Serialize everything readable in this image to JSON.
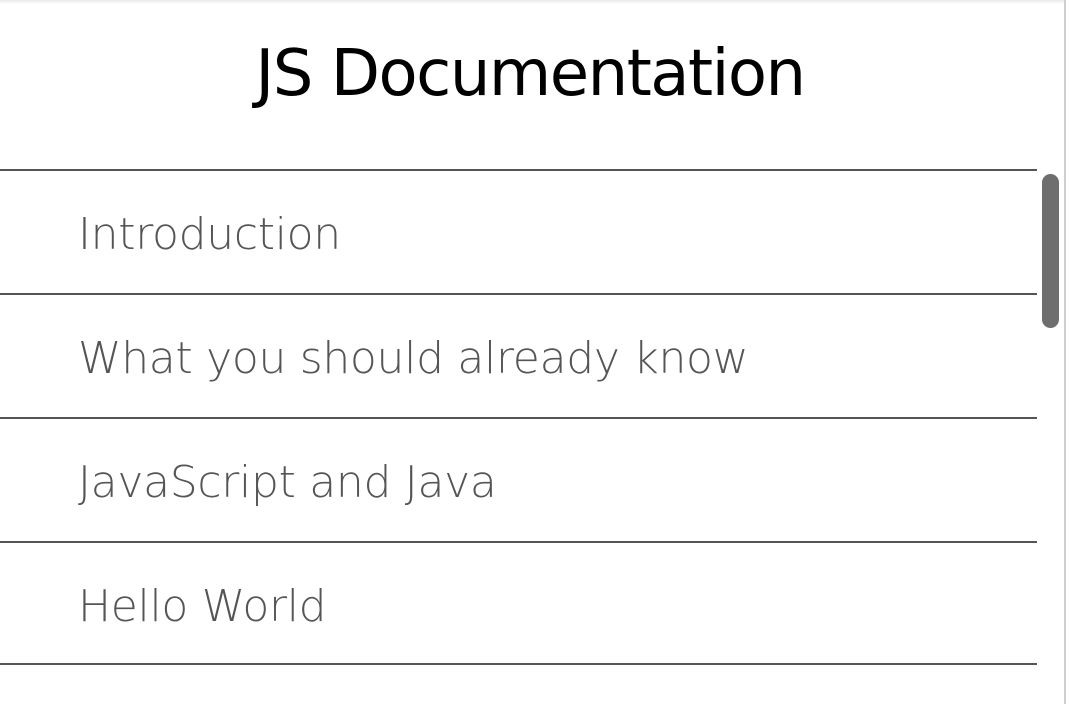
{
  "nav": {
    "title": "JS Documentation",
    "items": [
      {
        "label": "Introduction"
      },
      {
        "label": "What you should already know"
      },
      {
        "label": "JavaScript and Java"
      },
      {
        "label": "Hello World"
      }
    ]
  },
  "colors": {
    "title": "#000000",
    "link_text": "#555555",
    "divider": "#555555",
    "scrollbar_thumb": "#6e6e6e"
  }
}
